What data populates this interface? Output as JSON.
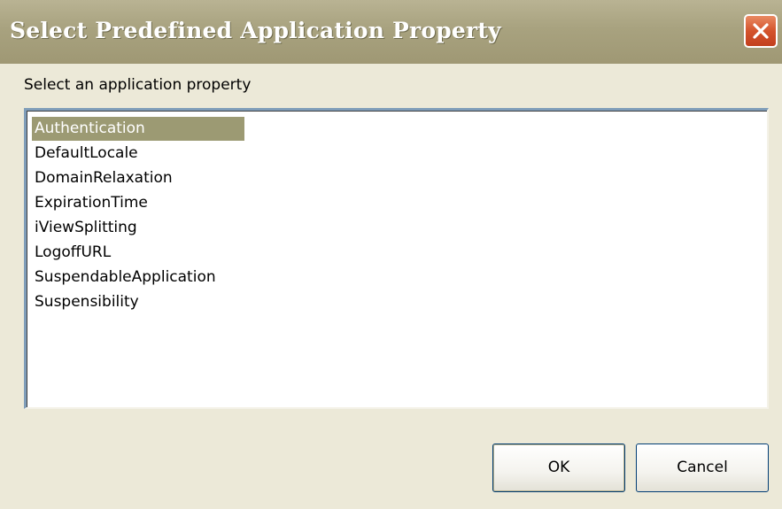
{
  "window": {
    "title": "Select Predefined Application Property",
    "close_icon": "close-icon",
    "title_color": "#ffffff",
    "titlebar_color": "#a8a27f"
  },
  "prompt": {
    "label": "Select an application property"
  },
  "properties": {
    "selected_index": 0,
    "selected_color": "#9c9a73",
    "items": [
      "Authentication",
      "DefaultLocale",
      "DomainRelaxation",
      "ExpirationTime",
      "iViewSplitting",
      "LogoffURL",
      "SuspendableApplication",
      "Suspensibility"
    ]
  },
  "buttons": {
    "ok_label": "OK",
    "cancel_label": "Cancel"
  }
}
